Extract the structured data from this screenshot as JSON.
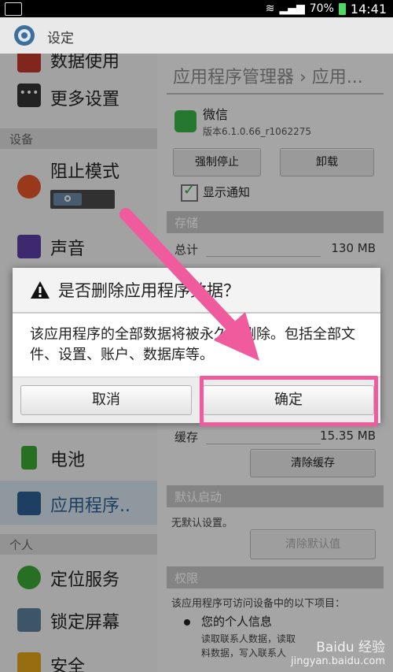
{
  "status": {
    "battery": "70%",
    "time": "14:41"
  },
  "header": {
    "title": "设定"
  },
  "sidebar": {
    "items_top": [
      {
        "label": "数据使用",
        "icon": "data-usage-icon"
      },
      {
        "label": "更多设置",
        "icon": "more-icon"
      }
    ],
    "section_device": "设备",
    "blocking": {
      "label": "阻止模式",
      "icon": "block-icon"
    },
    "items_device": [
      {
        "label": "声音",
        "icon": "sound-icon"
      },
      {
        "label": "电池",
        "icon": "battery-icon"
      },
      {
        "label": "应用程序..",
        "icon": "apps-icon"
      }
    ],
    "section_personal": "个人",
    "items_personal": [
      {
        "label": "定位服务",
        "icon": "location-icon"
      },
      {
        "label": "锁定屏幕",
        "icon": "lockscreen-icon"
      },
      {
        "label": "安全",
        "icon": "security-icon"
      }
    ]
  },
  "detail": {
    "breadcrumb": "应用程序管理器 › 应用...",
    "app_name": "微信",
    "app_version": "版本6.1.0.66_r1062275",
    "force_stop": "强制停止",
    "uninstall": "卸载",
    "show_notifications": "显示通知",
    "storage_header": "存储",
    "total_label": "总计",
    "total_value": "130 MB",
    "cache_label": "缓存",
    "cache_value": "15.35 MB",
    "clear_cache": "清除缓存",
    "default_header": "默认启动",
    "no_default": "无默认设置。",
    "clear_defaults": "清除默认值",
    "perm_header": "权限",
    "perm_desc": "该应用程序可访问设备中的以下项目：",
    "perm_item": "您的个人信息",
    "perm_detail_1": "读取联系人数据，读取",
    "perm_detail_2": "料数据，写入联系人"
  },
  "dialog": {
    "title": "是否删除应用程序数据？",
    "message": "该应用程序的全部数据将被永久性删除。包括全部文件、设置、账户、数据库等。",
    "cancel": "取消",
    "confirm": "确定"
  },
  "watermark": {
    "brand": "Baidu 经验",
    "url": "jingyan.baidu.com"
  },
  "colors": {
    "highlight": "#ef5b9c",
    "wechat": "#3ab34a"
  }
}
